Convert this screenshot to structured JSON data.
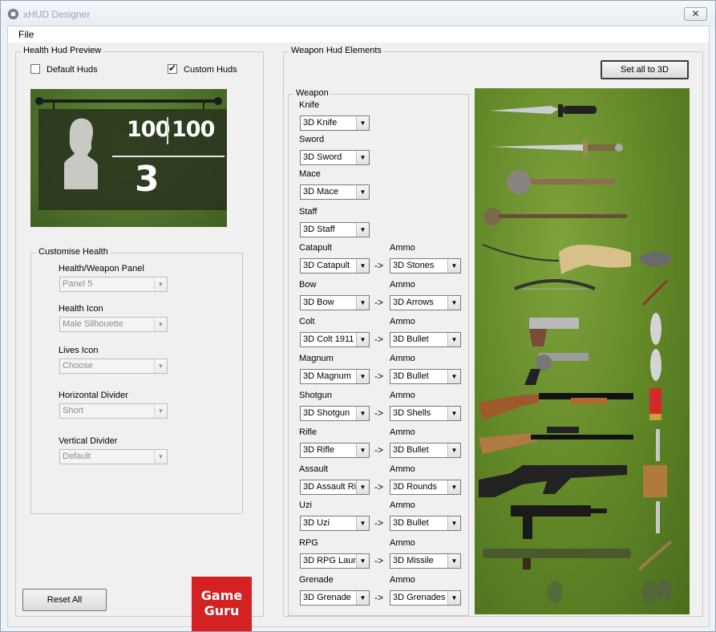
{
  "window": {
    "title": "xHUD Designer",
    "close_glyph": "✕"
  },
  "menu": {
    "file": "File"
  },
  "health_preview": {
    "title": "Health Hud Preview",
    "default_huds": "Default Huds",
    "custom_huds": "Custom Huds",
    "default_checked": false,
    "custom_checked": true,
    "health": "100",
    "max_health": "100",
    "lives": "3"
  },
  "customise": {
    "title": "Customise Health",
    "panel_label": "Health/Weapon Panel",
    "panel_value": "Panel 5",
    "icon_label": "Health Icon",
    "icon_value": "Male Silhouette",
    "lives_label": "Lives Icon",
    "lives_value": "Choose",
    "hdiv_label": "Horizontal Divider",
    "hdiv_value": "Short",
    "vdiv_label": "Vertical Divider",
    "vdiv_value": "Default"
  },
  "reset_button": "Reset All",
  "logo": {
    "line1": "Game",
    "line2": "Guru"
  },
  "weapon_hud": {
    "title": "Weapon Hud Elements",
    "set_all": "Set all to 3D",
    "weapon_group": "Weapon",
    "arrow": "->",
    "items": [
      {
        "label": "Knife",
        "value": "3D Knife"
      },
      {
        "label": "Sword",
        "value": "3D Sword"
      },
      {
        "label": "Mace",
        "value": "3D Mace"
      },
      {
        "label": "Staff",
        "value": "3D Staff"
      },
      {
        "label": "Catapult",
        "value": "3D Catapult",
        "ammo_label": "Ammo",
        "ammo": "3D Stones"
      },
      {
        "label": "Bow",
        "value": "3D Bow",
        "ammo_label": "Ammo",
        "ammo": "3D Arrows"
      },
      {
        "label": "Colt",
        "value": "3D Colt 1911",
        "ammo_label": "Ammo",
        "ammo": "3D Bullet"
      },
      {
        "label": "Magnum",
        "value": "3D Magnum",
        "ammo_label": "Ammo",
        "ammo": "3D Bullet"
      },
      {
        "label": "Shotgun",
        "value": "3D Shotgun",
        "ammo_label": "Ammo",
        "ammo": "3D Shells"
      },
      {
        "label": "Rifle",
        "value": "3D Rifle",
        "ammo_label": "Ammo",
        "ammo": "3D Bullet"
      },
      {
        "label": "Assault",
        "value": "3D Assault Ri",
        "ammo_label": "Ammo",
        "ammo": "3D Rounds"
      },
      {
        "label": "Uzi",
        "value": "3D Uzi",
        "ammo_label": "Ammo",
        "ammo": "3D Bullet"
      },
      {
        "label": "RPG",
        "value": "3D RPG Laun",
        "ammo_label": "Ammo",
        "ammo": "3D Missile"
      },
      {
        "label": "Grenade",
        "value": "3D Grenade",
        "ammo_label": "Ammo",
        "ammo": "3D Grenades"
      }
    ]
  }
}
